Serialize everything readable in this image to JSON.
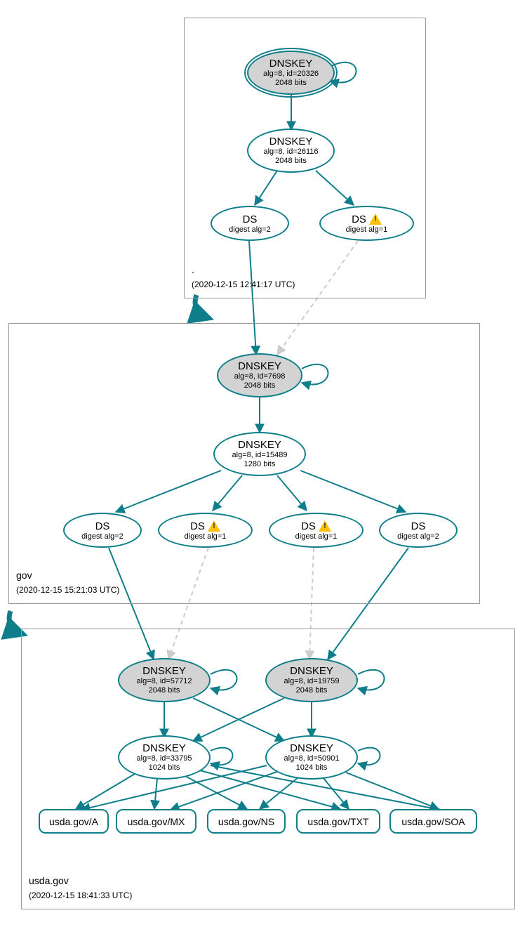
{
  "zones": {
    "root": {
      "name": ".",
      "timestamp": "(2020-12-15 12:41:17 UTC)"
    },
    "gov": {
      "name": "gov",
      "timestamp": "(2020-12-15 15:21:03 UTC)"
    },
    "usda": {
      "name": "usda.gov",
      "timestamp": "(2020-12-15 18:41:33 UTC)"
    }
  },
  "nodes": {
    "root_ksk": {
      "t": "DNSKEY",
      "sub1": "alg=8, id=20326",
      "sub2": "2048 bits"
    },
    "root_zsk": {
      "t": "DNSKEY",
      "sub1": "alg=8, id=26116",
      "sub2": "2048 bits"
    },
    "root_ds1": {
      "t": "DS",
      "sub": "digest alg=2"
    },
    "root_ds2": {
      "t": "DS",
      "sub": "digest alg=1"
    },
    "gov_ksk": {
      "t": "DNSKEY",
      "sub1": "alg=8, id=7698",
      "sub2": "2048 bits"
    },
    "gov_zsk": {
      "t": "DNSKEY",
      "sub1": "alg=8, id=15489",
      "sub2": "1280 bits"
    },
    "gov_ds1": {
      "t": "DS",
      "sub": "digest alg=2"
    },
    "gov_ds2": {
      "t": "DS",
      "sub": "digest alg=1"
    },
    "gov_ds3": {
      "t": "DS",
      "sub": "digest alg=1"
    },
    "gov_ds4": {
      "t": "DS",
      "sub": "digest alg=2"
    },
    "usda_ksk1": {
      "t": "DNSKEY",
      "sub1": "alg=8, id=57712",
      "sub2": "2048 bits"
    },
    "usda_ksk2": {
      "t": "DNSKEY",
      "sub1": "alg=8, id=19759",
      "sub2": "2048 bits"
    },
    "usda_zsk1": {
      "t": "DNSKEY",
      "sub1": "alg=8, id=33795",
      "sub2": "1024 bits"
    },
    "usda_zsk2": {
      "t": "DNSKEY",
      "sub1": "alg=8, id=50901",
      "sub2": "1024 bits"
    }
  },
  "records": {
    "a": "usda.gov/A",
    "mx": "usda.gov/MX",
    "ns": "usda.gov/NS",
    "txt": "usda.gov/TXT",
    "soa": "usda.gov/SOA"
  }
}
